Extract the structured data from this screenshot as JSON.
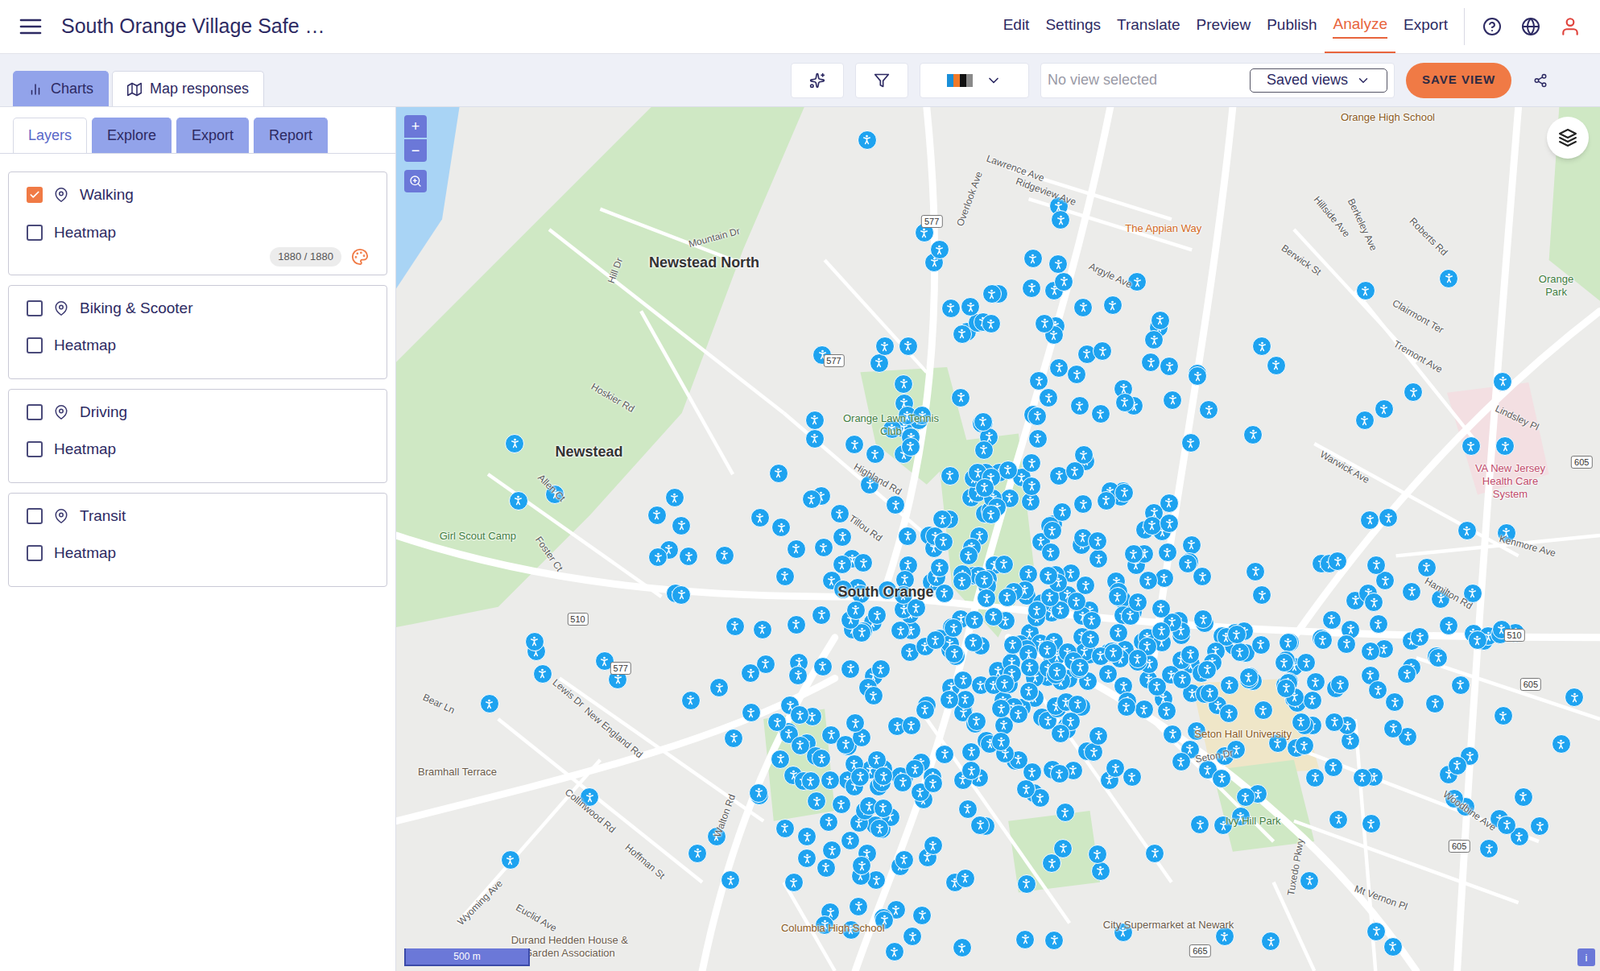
{
  "header": {
    "title": "South Orange Village Safe …",
    "nav": [
      {
        "label": "Edit",
        "selected": false
      },
      {
        "label": "Settings",
        "selected": false
      },
      {
        "label": "Translate",
        "selected": false
      },
      {
        "label": "Preview",
        "selected": false
      },
      {
        "label": "Publish",
        "selected": false
      },
      {
        "label": "Analyze",
        "selected": true
      },
      {
        "label": "Export",
        "selected": false
      }
    ]
  },
  "view_tabs": [
    {
      "label": "Charts",
      "selected": false
    },
    {
      "label": "Map responses",
      "selected": true
    }
  ],
  "toolbar": {
    "palette_colors": [
      "#1a8fd8",
      "#f07a2a",
      "#111111",
      "#8a8a8a"
    ],
    "view_placeholder": "No view selected",
    "saved_views": "Saved views",
    "save_button": "SAVE VIEW"
  },
  "panel_tabs": [
    {
      "label": "Layers",
      "selected": true
    },
    {
      "label": "Explore",
      "selected": false
    },
    {
      "label": "Export",
      "selected": false
    },
    {
      "label": "Report",
      "selected": false
    }
  ],
  "layers": [
    {
      "name": "Walking",
      "checked": true,
      "heatmap_label": "Heatmap",
      "heatmap_checked": false,
      "count": "1880 / 1880"
    },
    {
      "name": "Biking & Scooter",
      "checked": false,
      "heatmap_label": "Heatmap",
      "heatmap_checked": false
    },
    {
      "name": "Driving",
      "checked": false,
      "heatmap_label": "Heatmap",
      "heatmap_checked": false
    },
    {
      "name": "Transit",
      "checked": false,
      "heatmap_label": "Heatmap",
      "heatmap_checked": false
    }
  ],
  "map": {
    "labels": [
      {
        "text": "Orange High School",
        "kind": "school"
      },
      {
        "text": "Newstead North",
        "kind": "place"
      },
      {
        "text": "Newstead",
        "kind": "place"
      },
      {
        "text": "South Orange",
        "kind": "place"
      },
      {
        "text": "The Appian Way",
        "kind": "food"
      },
      {
        "text": "Orange Lawn Tennis Club",
        "kind": "park"
      },
      {
        "text": "Seton Hall University",
        "kind": "school"
      },
      {
        "text": "Ivy Hill Park",
        "kind": "park"
      },
      {
        "text": "VA New Jersey Health Care System",
        "kind": "hospital"
      },
      {
        "text": "Columbia High School",
        "kind": "school"
      },
      {
        "text": "Durand Hedden House & Garden Association",
        "kind": "poi"
      },
      {
        "text": "City Supermarket at Newark",
        "kind": "poi"
      },
      {
        "text": "Girl Scout Camp",
        "kind": "park"
      },
      {
        "text": "Bramhall Terrace",
        "kind": "poi"
      },
      {
        "text": "Orange Park",
        "kind": "park"
      },
      {
        "text": "Mountain Dr",
        "kind": "street"
      },
      {
        "text": "Hoskier Rd",
        "kind": "street"
      },
      {
        "text": "Allen Ct",
        "kind": "street"
      },
      {
        "text": "Foster Ct",
        "kind": "street"
      },
      {
        "text": "Highland Rd",
        "kind": "street"
      },
      {
        "text": "Tillou Rd",
        "kind": "street"
      },
      {
        "text": "Lawrence Ave",
        "kind": "street"
      },
      {
        "text": "Ridgeview Ave",
        "kind": "street"
      },
      {
        "text": "Overlook Ave",
        "kind": "street"
      },
      {
        "text": "Argyle Ave",
        "kind": "street"
      },
      {
        "text": "Warwick Ave",
        "kind": "street"
      },
      {
        "text": "Tremont Ave",
        "kind": "street"
      },
      {
        "text": "Clairmont Ter",
        "kind": "street"
      },
      {
        "text": "Lindsley Pl",
        "kind": "street"
      },
      {
        "text": "Kenmore Ave",
        "kind": "street"
      },
      {
        "text": "Hamilton Rd",
        "kind": "street"
      },
      {
        "text": "Seton Dr",
        "kind": "street"
      },
      {
        "text": "Woodbine Ave",
        "kind": "street"
      },
      {
        "text": "Mt Vernon Pl",
        "kind": "street"
      },
      {
        "text": "Tuxedo Pkwy",
        "kind": "street"
      },
      {
        "text": "Wyoming Ave",
        "kind": "street"
      },
      {
        "text": "Euclid Ave",
        "kind": "street"
      },
      {
        "text": "Collinwood Rd",
        "kind": "street"
      },
      {
        "text": "Hoffman St",
        "kind": "street"
      },
      {
        "text": "Walton Rd",
        "kind": "street"
      },
      {
        "text": "New England Rd",
        "kind": "street"
      },
      {
        "text": "Bear Ln",
        "kind": "street"
      },
      {
        "text": "Lewis Dr",
        "kind": "street"
      },
      {
        "text": "Hill Dr",
        "kind": "street"
      },
      {
        "text": "Berwick St",
        "kind": "street"
      },
      {
        "text": "Hillside Ave",
        "kind": "street"
      },
      {
        "text": "Berkeley Ave",
        "kind": "street"
      },
      {
        "text": "Roberts Rd",
        "kind": "street"
      },
      {
        "text": "577",
        "kind": "shield"
      },
      {
        "text": "577",
        "kind": "shield"
      },
      {
        "text": "577",
        "kind": "shield"
      },
      {
        "text": "510",
        "kind": "shield"
      },
      {
        "text": "510",
        "kind": "shield"
      },
      {
        "text": "605",
        "kind": "shield"
      },
      {
        "text": "605",
        "kind": "shield"
      },
      {
        "text": "605",
        "kind": "shield"
      },
      {
        "text": "665",
        "kind": "shield"
      }
    ],
    "zoom_in": "+",
    "zoom_out": "−",
    "scale": "500 m",
    "info": "i"
  }
}
